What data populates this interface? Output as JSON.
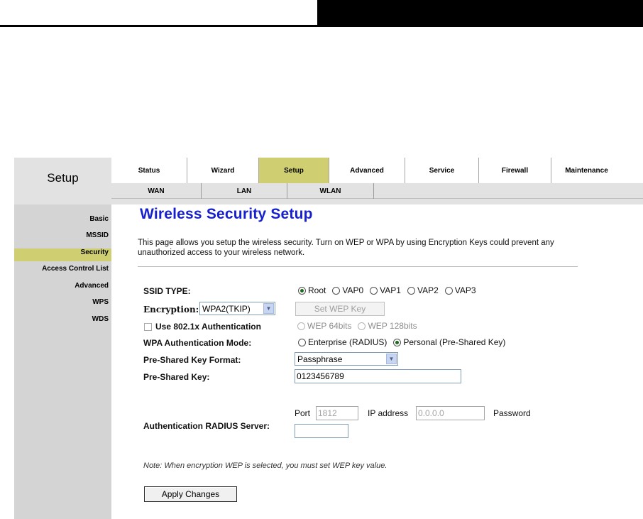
{
  "brand": "Setup",
  "main_tabs": [
    {
      "label": "Status",
      "active": false
    },
    {
      "label": "Wizard",
      "active": false
    },
    {
      "label": "Setup",
      "active": true
    },
    {
      "label": "Advanced",
      "active": false
    },
    {
      "label": "Service",
      "active": false
    },
    {
      "label": "Firewall",
      "active": false
    },
    {
      "label": "Maintenance",
      "active": false
    }
  ],
  "sub_tabs": [
    {
      "label": "WAN"
    },
    {
      "label": "LAN"
    },
    {
      "label": "WLAN"
    }
  ],
  "sidebar": [
    {
      "label": "Basic",
      "active": false
    },
    {
      "label": "MSSID",
      "active": false
    },
    {
      "label": "Security",
      "active": true
    },
    {
      "label": "Access Control List",
      "active": false
    },
    {
      "label": "Advanced",
      "active": false
    },
    {
      "label": "WPS",
      "active": false
    },
    {
      "label": "WDS",
      "active": false
    }
  ],
  "page": {
    "title": "Wireless Security Setup",
    "description": "This page allows you setup the wireless security. Turn on WEP or WPA by using Encryption Keys could prevent any unauthorized access to your wireless network."
  },
  "form": {
    "ssid_type": {
      "label": "SSID TYPE:",
      "options": [
        "Root",
        "VAP0",
        "VAP1",
        "VAP2",
        "VAP3"
      ],
      "selected": "Root"
    },
    "encryption": {
      "label": "Encryption:",
      "value": "WPA2(TKIP)",
      "set_wep_key_button": "Set WEP Key"
    },
    "use_8021x": {
      "label": "Use 802.1x Authentication",
      "checked": false,
      "wep_options": [
        "WEP 64bits",
        "WEP 128bits"
      ]
    },
    "wpa_auth_mode": {
      "label": "WPA Authentication Mode:",
      "options": [
        "Enterprise (RADIUS)",
        "Personal (Pre-Shared Key)"
      ],
      "selected": "Personal (Pre-Shared Key)"
    },
    "psk_format": {
      "label": "Pre-Shared Key Format:",
      "value": "Passphrase"
    },
    "psk": {
      "label": "Pre-Shared Key:",
      "value": "0123456789"
    },
    "radius": {
      "label": "Authentication RADIUS Server:",
      "port_label": "Port",
      "port_value": "1812",
      "ip_label": "IP address",
      "ip_value": "0.0.0.0",
      "password_label": "Password",
      "password_value": ""
    },
    "note": "Note: When encryption WEP is selected, you must set WEP key value.",
    "apply_button": "Apply Changes"
  }
}
